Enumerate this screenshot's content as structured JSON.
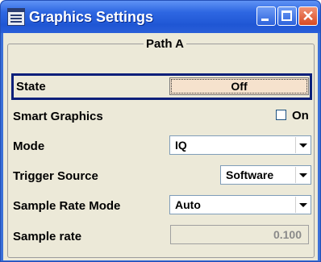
{
  "window": {
    "title": "Graphics Settings",
    "icon": "window-app-icon",
    "buttons": [
      "minimize",
      "maximize",
      "close"
    ],
    "close_glyph": "✕"
  },
  "group": {
    "title": "Path A"
  },
  "rows": {
    "state": {
      "label": "State",
      "button": "Off"
    },
    "smart_graphics": {
      "label": "Smart Graphics",
      "checkbox_label": "On",
      "checked": false
    },
    "mode": {
      "label": "Mode",
      "value": "IQ"
    },
    "trigger_source": {
      "label": "Trigger Source",
      "value": "Software"
    },
    "sample_rate_mode": {
      "label": "Sample Rate Mode",
      "value": "Auto"
    },
    "sample_rate": {
      "label": "Sample rate",
      "value": "0.100"
    }
  },
  "colors": {
    "titlebar": "#2e67e2",
    "client_bg": "#ece9d8",
    "state_button_bg": "#f6e2cd",
    "selection_border": "#0a1f7a",
    "close_button": "#d84a22"
  }
}
